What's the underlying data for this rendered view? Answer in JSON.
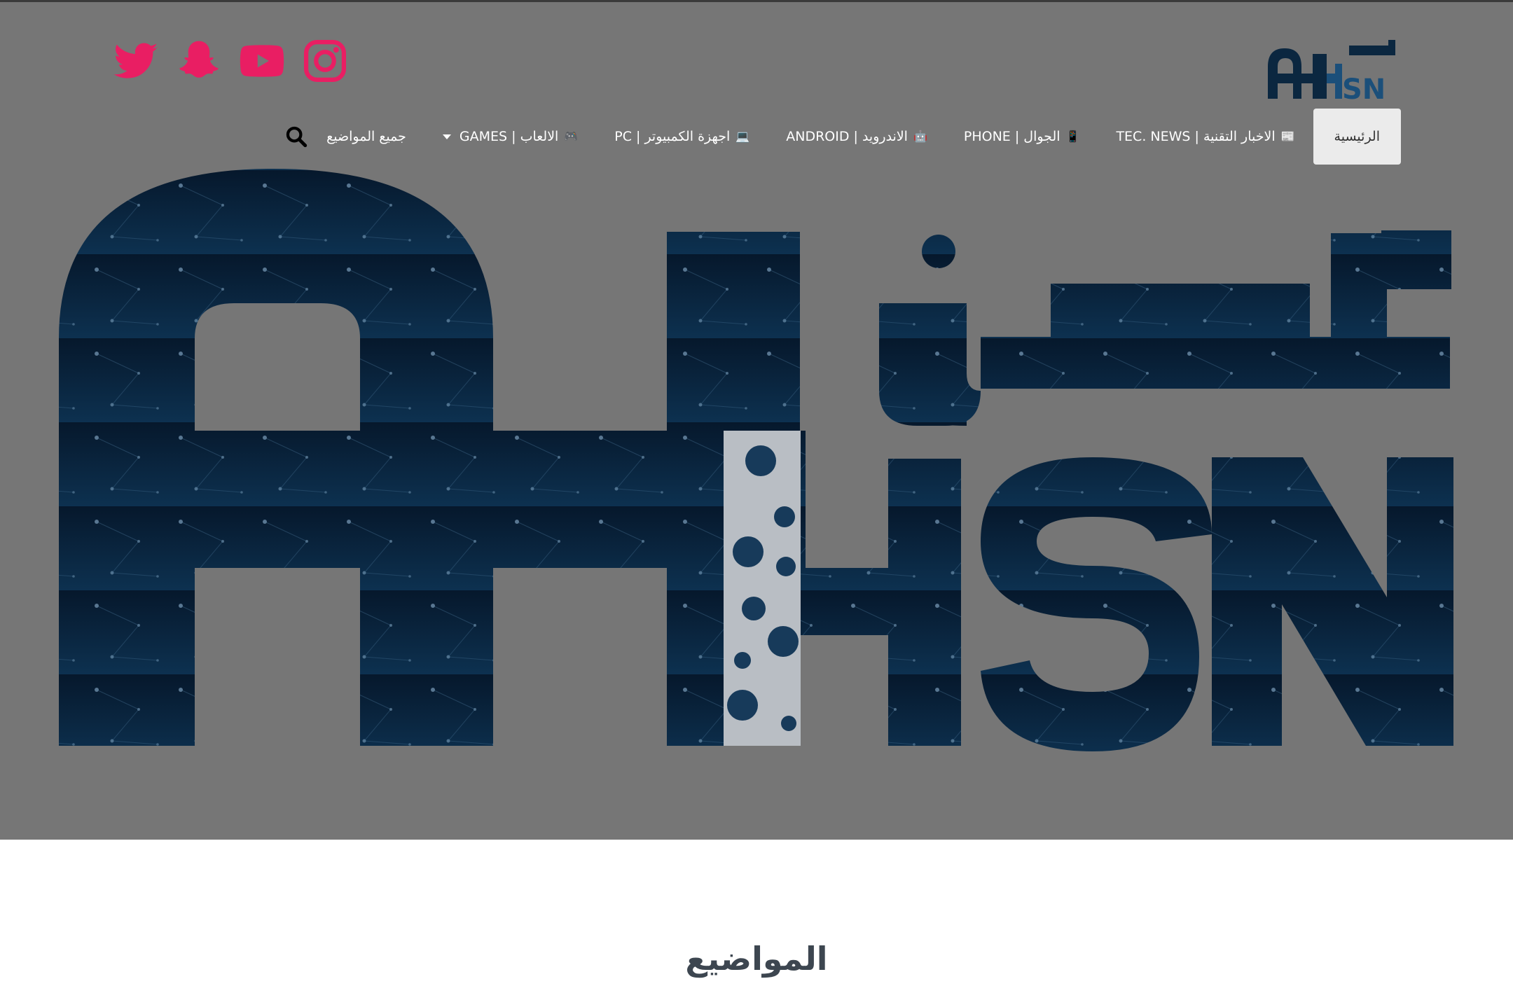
{
  "brand": {
    "logo_text_arabic": "أحسن",
    "logo_text_latin": "AHSN"
  },
  "social": [
    {
      "name": "twitter-icon",
      "color": "#e91e63"
    },
    {
      "name": "snapchat-icon",
      "color": "#e91e63"
    },
    {
      "name": "youtube-icon",
      "color": "#e91e63"
    },
    {
      "name": "instagram-icon",
      "color": "#e91e63"
    }
  ],
  "nav": {
    "items": [
      {
        "label": "الرئيسية",
        "icon": "",
        "active": true
      },
      {
        "label": "TEC. NEWS | الاخبار التقنية",
        "icon": "📰"
      },
      {
        "label": "PHONE | الجوال",
        "icon": "📱"
      },
      {
        "label": "ANDROID | الاندرويد",
        "icon": "🤖"
      },
      {
        "label": "PC | اجهزة الكمبيوتر",
        "icon": "💻"
      },
      {
        "label": "GAMES | الالعاب",
        "icon": "🎮",
        "dropdown": true
      },
      {
        "label": "جميع المواضيع",
        "icon": ""
      }
    ]
  },
  "main": {
    "section_title": "المواضيع"
  },
  "colors": {
    "accent": "#e91e63",
    "hero_bg": "#767676",
    "logo_navy": "#0b2740"
  }
}
